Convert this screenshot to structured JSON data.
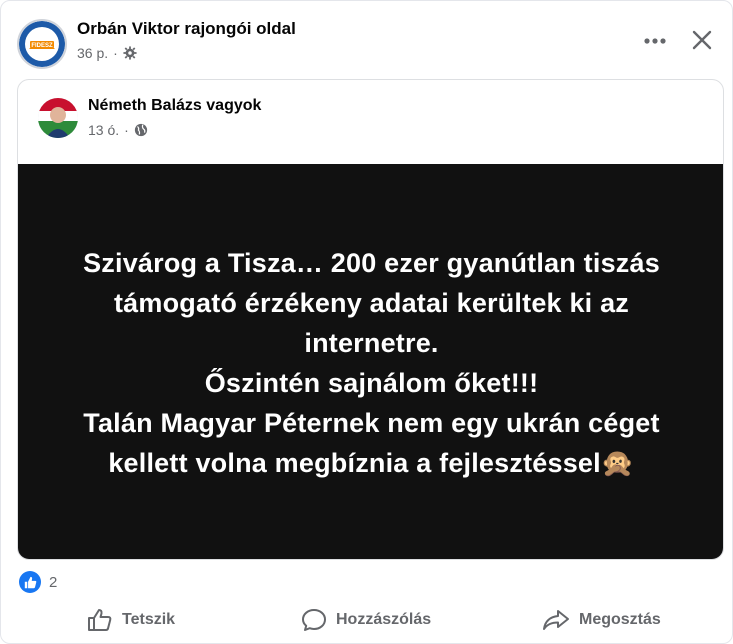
{
  "post": {
    "page_name": "Orbán Viktor rajongói oldal",
    "time": "36 p.",
    "privacy_icon": "gear-icon",
    "avatar_text": "FIDESZ",
    "shared": {
      "author_name": "Németh Balázs vagyok",
      "time": "13 ó.",
      "privacy_icon": "globe-icon",
      "image_text_lines": [
        "Szivárog a Tisza… 200 ezer gyanútlan tiszás",
        "támogató érzékeny adatai kerültek ki az",
        "internetre.",
        "Őszintén sajnálom őket!!!",
        "Talán Magyar Péternek nem egy ukrán céget",
        "kellett volna megbíznia a fejlesztéssel🙊"
      ]
    },
    "reactions": {
      "icon": "like-icon",
      "count": "2"
    },
    "actions": {
      "like_label": "Tetszik",
      "comment_label": "Hozzászólás",
      "share_label": "Megosztás"
    }
  },
  "colors": {
    "accent": "#1877f2",
    "image_background": "#111111",
    "secondary_text": "#65676b"
  }
}
